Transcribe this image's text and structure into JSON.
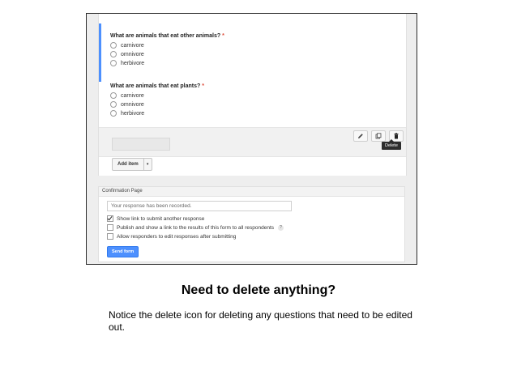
{
  "form": {
    "questions": [
      {
        "title": "What are animals that eat other animals?",
        "required_mark": "*",
        "options": [
          "carnivore",
          "omnivore",
          "herbivore"
        ]
      },
      {
        "title": "What are animals that eat plants?",
        "required_mark": "*",
        "options": [
          "carnivore",
          "omnivore",
          "herbivore"
        ]
      }
    ],
    "tooltip": "Delete",
    "add_item_label": "Add item",
    "confirmation": {
      "header": "Confirmation Page",
      "message_value": "Your response has been recorded.",
      "options": [
        {
          "label": "Show link to submit another response",
          "checked": true
        },
        {
          "label": "Publish and show a link to the results of this form to all respondents",
          "checked": false,
          "help": "?"
        },
        {
          "label": "Allow responders to edit responses after submitting",
          "checked": false
        }
      ],
      "send_button": "Send form"
    }
  },
  "slide": {
    "heading": "Need to delete anything?",
    "caption": "Notice the delete icon for deleting any questions that need to be edited out."
  },
  "colors": {
    "accent_blue": "#4d90fe",
    "required_red": "#dd4b39",
    "tooltip_dark": "#2d2d2d"
  }
}
